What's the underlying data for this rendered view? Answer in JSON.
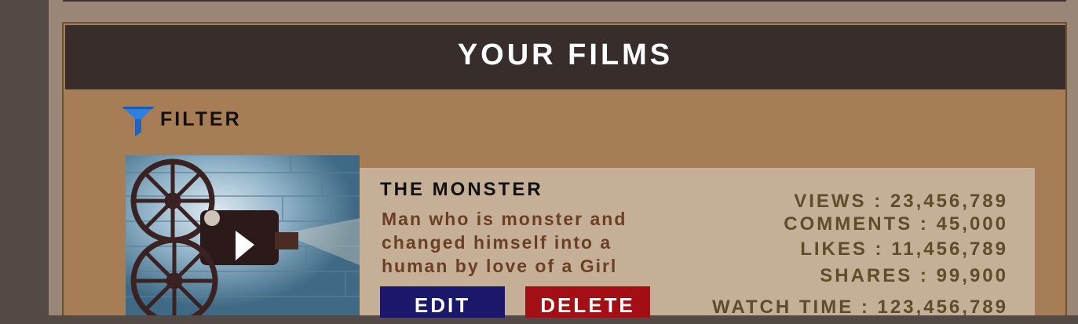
{
  "header": {
    "title": "YOUR FILMS"
  },
  "filter": {
    "label": "FILTER",
    "icon": "funnel-icon"
  },
  "films": [
    {
      "title": "THE MONSTER",
      "description_lines": [
        "Man who is monster and",
        "changed himself into a",
        "human by love of a Girl"
      ],
      "thumbnail_icon": "film-projector-image",
      "edit_label": "EDIT",
      "delete_label": "DELETE",
      "stats": {
        "views": "VIEWS : 23,456,789",
        "comments": "COMMENTS : 45,000",
        "likes": "LIKES : 11,456,789",
        "shares": "SHARES : 99,900",
        "watch_time": "WATCH TIME : 123,456,789"
      }
    }
  ],
  "colors": {
    "header_bg": "#372e2c",
    "panel_bg": "#a67d54",
    "card_bg": "#c5b097",
    "edit_button": "#1b176b",
    "delete_button": "#a40e15",
    "description_text": "#6b3f24",
    "stats_text": "#5e4c2a",
    "filter_icon": "#2f7fe0"
  }
}
